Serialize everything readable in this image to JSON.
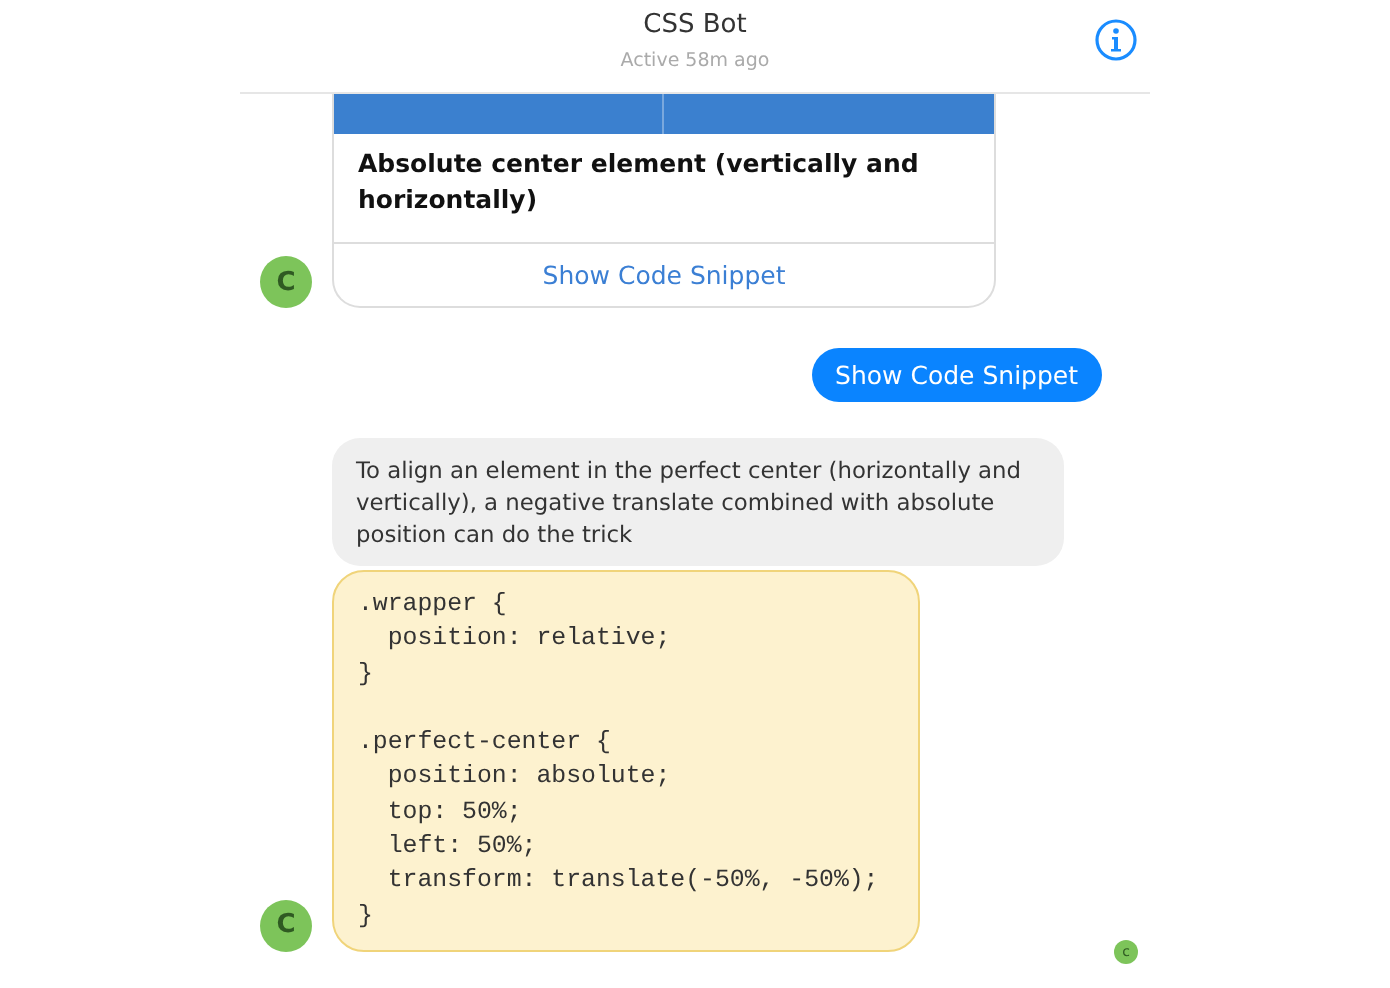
{
  "header": {
    "title": "CSS Bot",
    "subtitle": "Active 58m ago"
  },
  "messages": [
    {
      "kind": "card",
      "avatar": "C",
      "title": "Absolute center element (vertically and horizontally)",
      "link": "Show Code Snippet"
    },
    {
      "kind": "sent",
      "text": "Show Code Snippet"
    },
    {
      "kind": "received",
      "text": "To align an element in the perfect center (horizontally and vertically), a negative translate combined with absolute position can do the trick"
    },
    {
      "kind": "code",
      "avatar": "C",
      "code": ".wrapper {\n  position: relative;\n}\n\n.perfect-center {\n  position: absolute;\n  top: 50%;\n  left: 50%;\n  transform: translate(-50%, -50%);\n}",
      "read_receipt": "c"
    }
  ]
}
